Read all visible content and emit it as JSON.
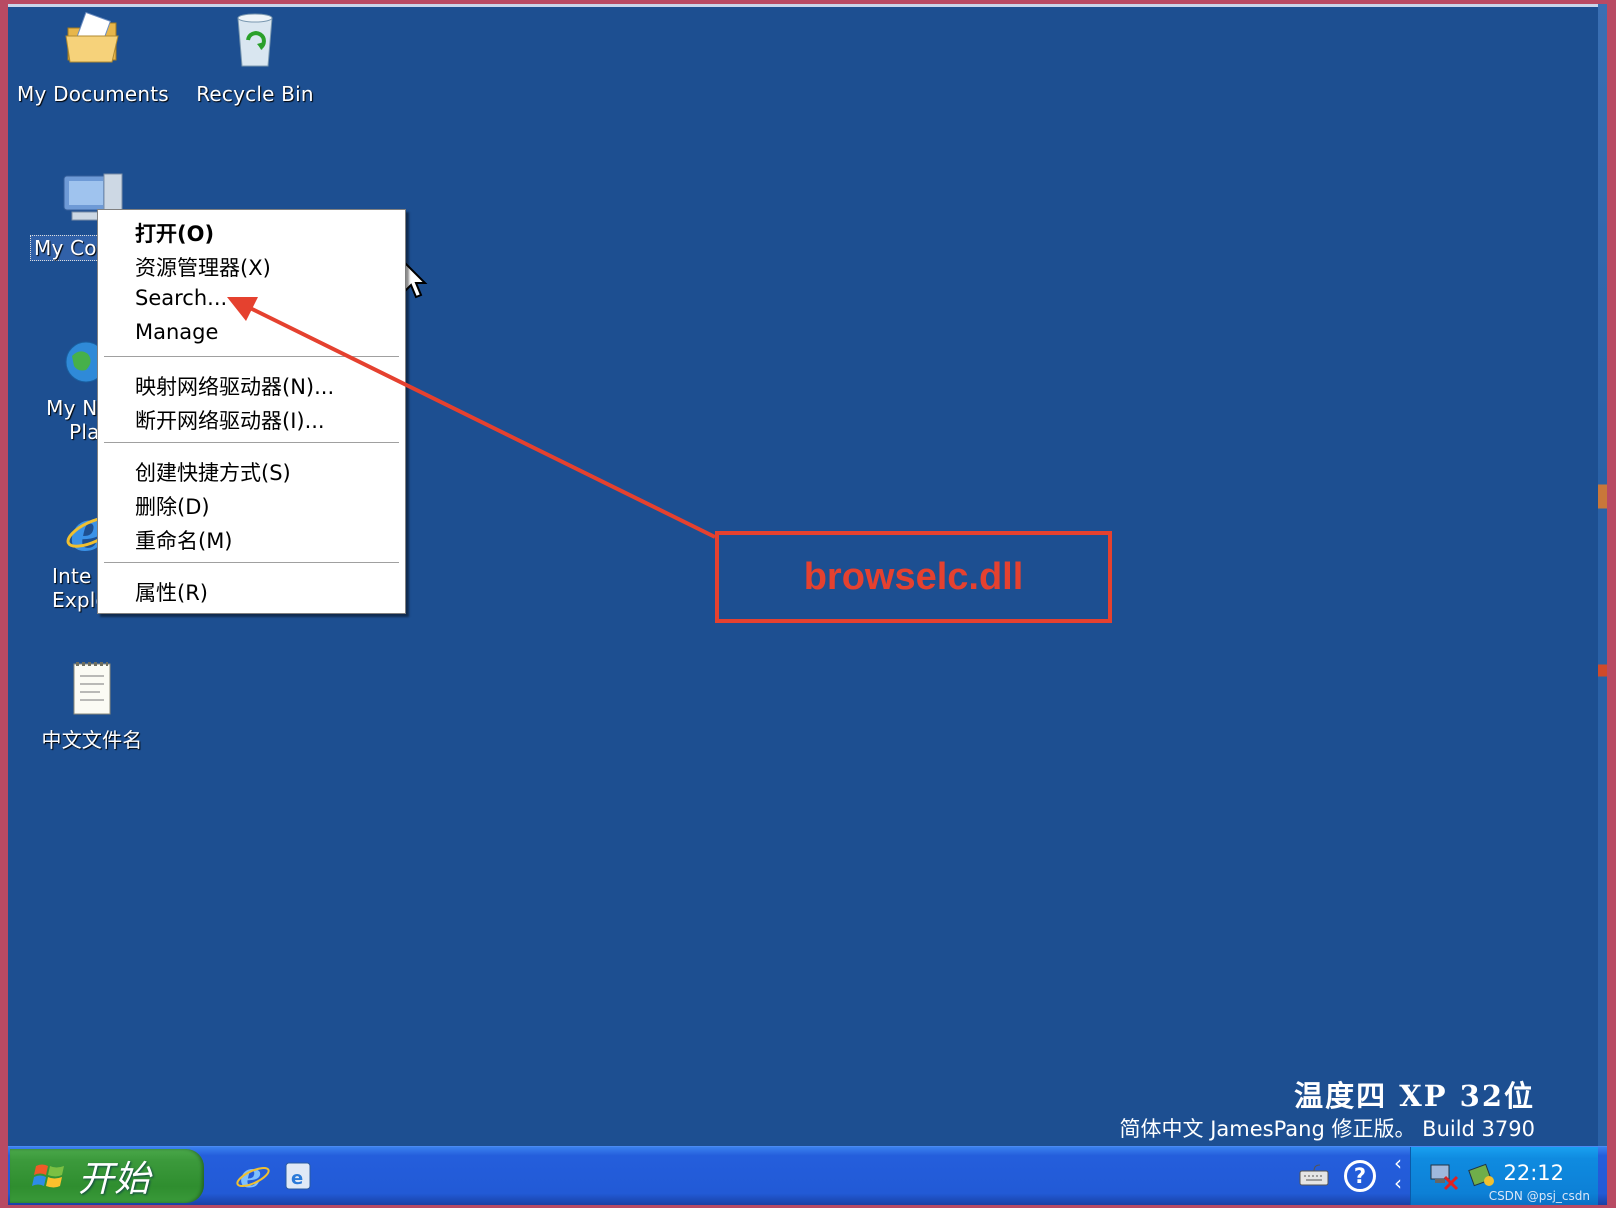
{
  "desktop": {
    "icons": [
      {
        "label": "My Documents"
      },
      {
        "label": "Recycle Bin"
      },
      {
        "label": "My Cor"
      },
      {
        "label_line1": "My Ne",
        "label_line2": "Plac"
      },
      {
        "label_line1": "Inte",
        "label_line2": "Explorer"
      },
      {
        "label": "中文文件名"
      }
    ]
  },
  "context_menu": {
    "items": [
      {
        "label": "打开(O)"
      },
      {
        "label": "资源管理器(X)"
      },
      {
        "label": "Search..."
      },
      {
        "label": "Manage"
      },
      {
        "label": "映射网络驱动器(N)..."
      },
      {
        "label": "断开网络驱动器(I)..."
      },
      {
        "label": "创建快捷方式(S)"
      },
      {
        "label": "删除(D)"
      },
      {
        "label": "重命名(M)"
      },
      {
        "label": "属性(R)"
      }
    ]
  },
  "annotation": {
    "text": "browselc.dll",
    "color": "#e5412f"
  },
  "brand": {
    "line1": "温度四 XP 32位",
    "line2": "简体中文 JamesPang 修正版。 Build 3790"
  },
  "taskbar": {
    "start_label": "开始",
    "clock": "22:12",
    "watermark": "CSDN @psj_csdn"
  },
  "colors": {
    "desktop": "#1d4f91",
    "taskbar": "#245edc",
    "start": "#3c9a3c",
    "tray": "#0f8be0"
  }
}
